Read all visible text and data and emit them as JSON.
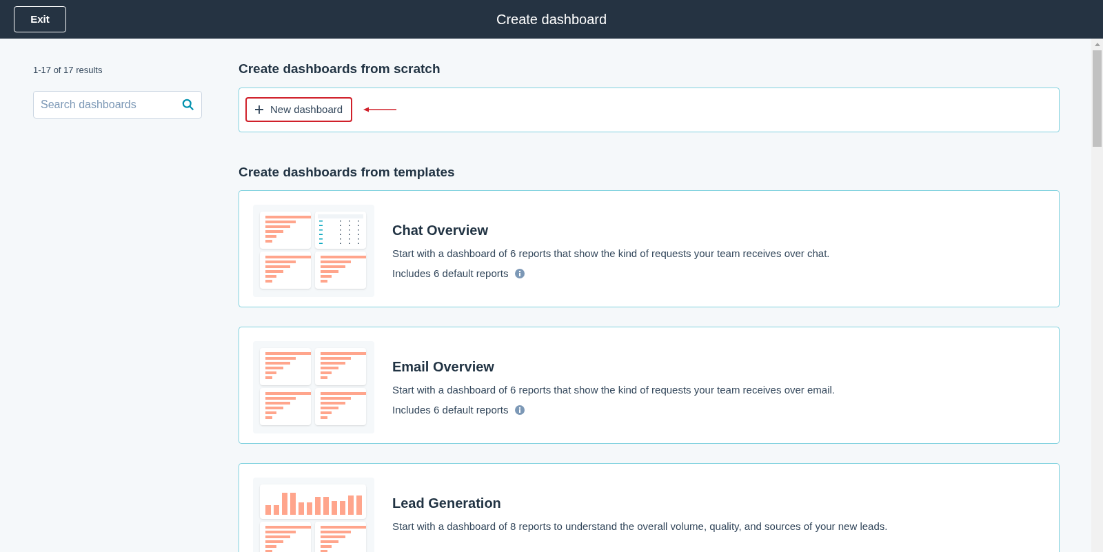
{
  "header": {
    "exit_button": "Exit",
    "title": "Create dashboard"
  },
  "sidebar": {
    "results_count": "1-17 of 17 results",
    "search": {
      "placeholder": "Search dashboards"
    }
  },
  "scratch": {
    "heading": "Create dashboards from scratch",
    "new_button": {
      "label": "New dashboard",
      "highlighted": true
    }
  },
  "templates": {
    "heading": "Create dashboards from templates",
    "items": [
      {
        "title": "Chat Overview",
        "description": "Start with a dashboard of 6 reports that show the kind of requests your team receives over chat.",
        "includes": "Includes 6 default reports",
        "thumbnails": [
          {
            "kind": "bars"
          },
          {
            "kind": "table"
          },
          {
            "kind": "bars"
          },
          {
            "kind": "bars"
          }
        ]
      },
      {
        "title": "Email Overview",
        "description": "Start with a dashboard of 6 reports that show the kind of requests your team receives over email.",
        "includes": "Includes 6 default reports",
        "thumbnails": [
          {
            "kind": "bars"
          },
          {
            "kind": "bars"
          },
          {
            "kind": "bars"
          },
          {
            "kind": "bars"
          }
        ]
      },
      {
        "title": "Lead Generation",
        "description": "Start with a dashboard of 8 reports to understand the overall volume, quality, and sources of your new leads.",
        "thumbnails": [
          {
            "kind": "columns"
          },
          {
            "kind": "bars"
          },
          {
            "kind": "bars"
          }
        ]
      }
    ]
  }
}
